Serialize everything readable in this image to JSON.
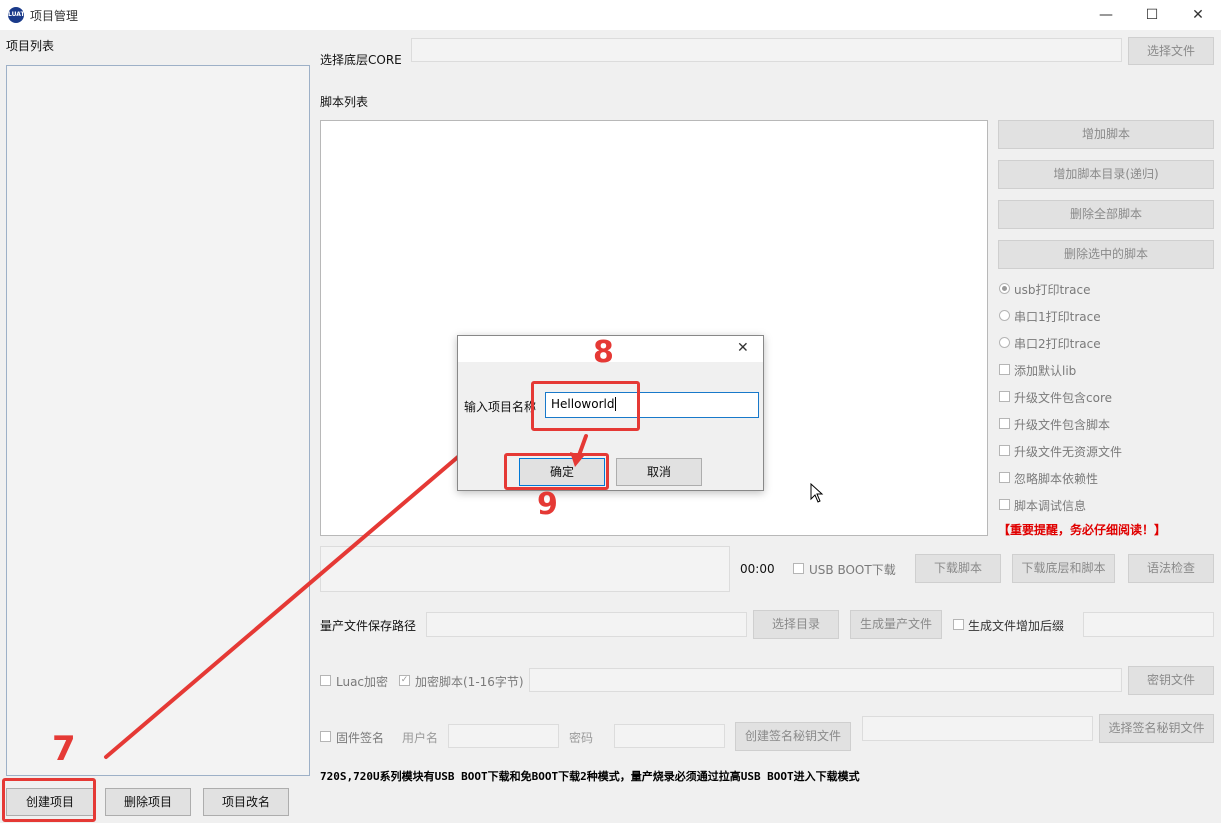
{
  "window": {
    "title": "项目管理",
    "icon_text": "LUAT",
    "controls": {
      "minimize": "—",
      "maximize": "☐",
      "close": "✕"
    }
  },
  "left_panel": {
    "title": "项目列表",
    "buttons": {
      "create": "创建项目",
      "delete": "删除项目",
      "rename": "项目改名"
    }
  },
  "core": {
    "label": "选择底层CORE",
    "value": "",
    "browse_button": "选择文件"
  },
  "script_list": {
    "label": "脚本列表",
    "buttons": {
      "add_script": "增加脚本",
      "add_dir": "增加脚本目录(递归)",
      "delete_all": "删除全部脚本",
      "delete_selected": "删除选中的脚本"
    },
    "trace_options": [
      {
        "label": "usb打印trace",
        "selected": true
      },
      {
        "label": "串口1打印trace",
        "selected": false
      },
      {
        "label": "串口2打印trace",
        "selected": false
      }
    ],
    "checkboxes": [
      {
        "label": "添加默认lib",
        "checked": false
      },
      {
        "label": "升级文件包含core",
        "checked": false
      },
      {
        "label": "升级文件包含脚本",
        "checked": false
      },
      {
        "label": "升级文件无资源文件",
        "checked": false
      },
      {
        "label": "忽略脚本依赖性",
        "checked": false
      },
      {
        "label": "脚本调试信息",
        "checked": false
      }
    ],
    "warning": "【重要提醒，务必仔细阅读！】"
  },
  "download": {
    "time": "00:00",
    "usb_boot_label": "USB BOOT下载",
    "buttons": {
      "download_script": "下载脚本",
      "download_core_script": "下载底层和脚本",
      "syntax_check": "语法检查"
    }
  },
  "mass_production": {
    "label": "量产文件保存路径",
    "choose_dir": "选择目录",
    "generate": "生成量产文件",
    "suffix_label": "生成文件增加后缀"
  },
  "encryption": {
    "luac_label": "Luac加密",
    "encrypt_script_label": "加密脚本(1-16字节)",
    "encrypt_script_checked": true,
    "key_file_button": "密钥文件"
  },
  "signature": {
    "firmware_sign_label": "固件签名",
    "username_label": "用户名",
    "password_label": "密码",
    "create_key_button": "创建签名秘钥文件",
    "select_key_button": "选择签名秘钥文件"
  },
  "footer_note": "720S,720U系列模块有USB BOOT下载和免BOOT下载2种模式，量产烧录必须通过拉高USB BOOT进入下载模式",
  "dialog": {
    "close": "✕",
    "prompt": "输入项目名称",
    "input_value": "Helloworld",
    "ok": "确定",
    "cancel": "取消"
  },
  "annotations": {
    "step7": "7",
    "step8": "8",
    "step9": "9",
    "color": "#e53935"
  }
}
